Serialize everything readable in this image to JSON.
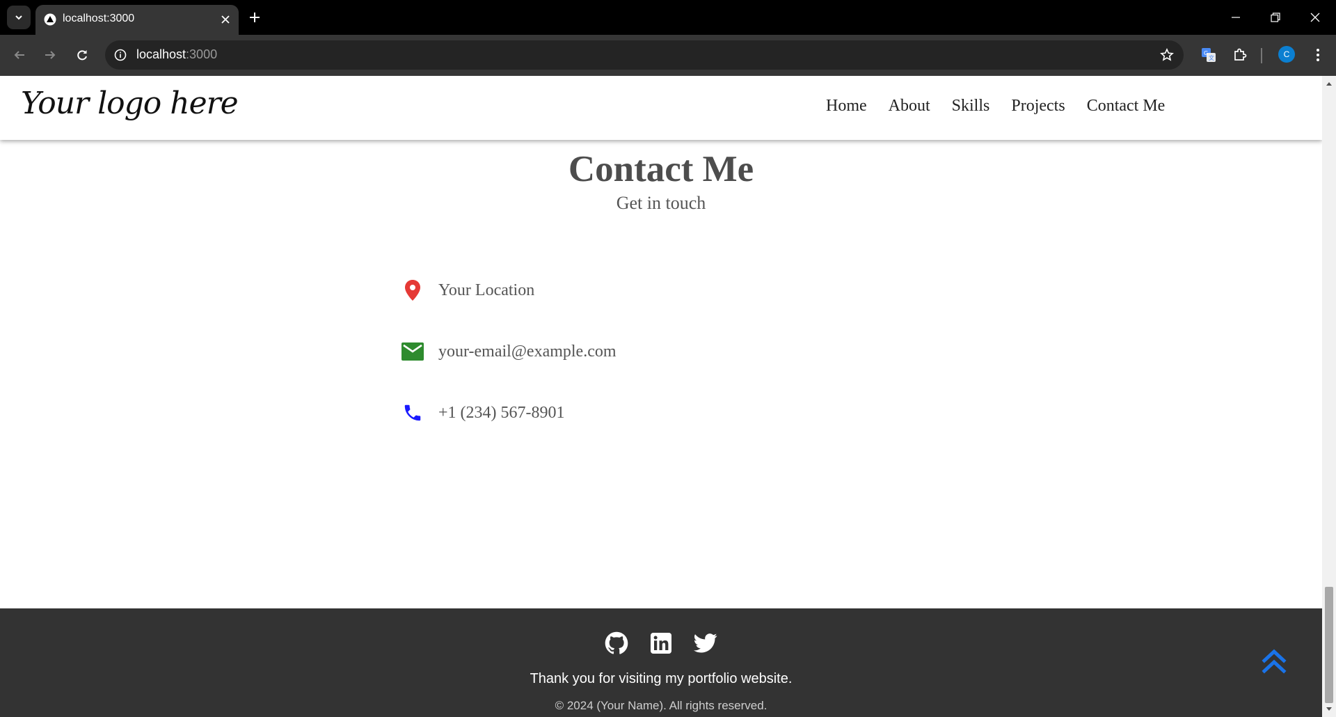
{
  "browser": {
    "tab_title": "localhost:3000",
    "url_host": "localhost",
    "url_port": ":3000",
    "profile_initial": "C"
  },
  "header": {
    "logo_text": "Your logo here",
    "nav": [
      "Home",
      "About",
      "Skills",
      "Projects",
      "Contact Me"
    ]
  },
  "contact": {
    "title": "Contact Me",
    "subtitle": "Get in touch",
    "items": [
      {
        "icon": "location-pin-icon",
        "text": "Your Location",
        "color": "#e53935"
      },
      {
        "icon": "mail-icon",
        "text": "your-email@example.com",
        "color": "#2e8b2e"
      },
      {
        "icon": "phone-icon",
        "text": "+1 (234) 567-8901",
        "color": "#1a1aff"
      }
    ]
  },
  "footer": {
    "social": [
      "github-icon",
      "linkedin-icon",
      "twitter-icon"
    ],
    "thanks": "Thank you for visiting my portfolio website.",
    "copyright": "© 2024 (Your Name). All rights reserved."
  },
  "colors": {
    "footer_bg": "#333333",
    "accent_back_to_top": "#1a73e8"
  }
}
